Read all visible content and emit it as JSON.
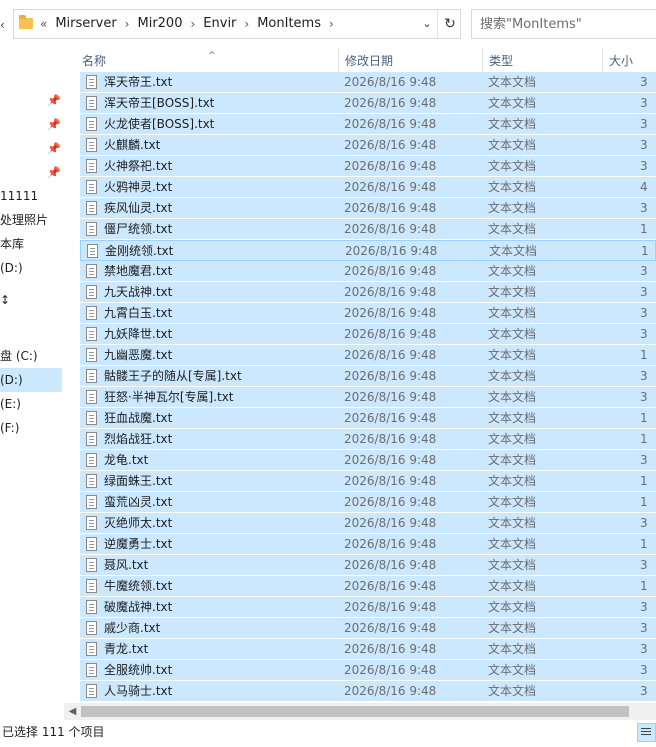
{
  "address": {
    "overflow": "«",
    "crumbs": [
      "Mirserver",
      "Mir200",
      "Envir",
      "MonItems"
    ]
  },
  "search": {
    "placeholder": "搜索\"MonItems\""
  },
  "sidebar": {
    "items": [
      {
        "label": "11111"
      },
      {
        "label": "处理照片"
      },
      {
        "label": "本库"
      },
      {
        "label": "(D:)"
      },
      {
        "label": "↕"
      },
      {
        "label": "盘 (C:)"
      },
      {
        "label": "(D:)"
      },
      {
        "label": "(E:)"
      },
      {
        "label": "(F:)"
      }
    ]
  },
  "columns": {
    "name": "名称",
    "date": "修改日期",
    "type": "类型",
    "size": "大小"
  },
  "files": [
    {
      "name": "浑天帝王.txt",
      "date": "2026/8/16 9:48",
      "type": "文本文档",
      "size": "3"
    },
    {
      "name": "浑天帝王[BOSS].txt",
      "date": "2026/8/16 9:48",
      "type": "文本文档",
      "size": "3"
    },
    {
      "name": "火龙使者[BOSS].txt",
      "date": "2026/8/16 9:48",
      "type": "文本文档",
      "size": "3"
    },
    {
      "name": "火麒麟.txt",
      "date": "2026/8/16 9:48",
      "type": "文本文档",
      "size": "3"
    },
    {
      "name": "火神祭祀.txt",
      "date": "2026/8/16 9:48",
      "type": "文本文档",
      "size": "3"
    },
    {
      "name": "火鸦神灵.txt",
      "date": "2026/8/16 9:48",
      "type": "文本文档",
      "size": "4"
    },
    {
      "name": "疾风仙灵.txt",
      "date": "2026/8/16 9:48",
      "type": "文本文档",
      "size": "3"
    },
    {
      "name": "僵尸统领.txt",
      "date": "2026/8/16 9:48",
      "type": "文本文档",
      "size": "1"
    },
    {
      "name": "金刚统领.txt",
      "date": "2026/8/16 9:48",
      "type": "文本文档",
      "size": "1"
    },
    {
      "name": "禁地魔君.txt",
      "date": "2026/8/16 9:48",
      "type": "文本文档",
      "size": "3"
    },
    {
      "name": "九天战神.txt",
      "date": "2026/8/16 9:48",
      "type": "文本文档",
      "size": "3"
    },
    {
      "name": "九霄白玉.txt",
      "date": "2026/8/16 9:48",
      "type": "文本文档",
      "size": "3"
    },
    {
      "name": "九妖降世.txt",
      "date": "2026/8/16 9:48",
      "type": "文本文档",
      "size": "3"
    },
    {
      "name": "九幽恶魔.txt",
      "date": "2026/8/16 9:48",
      "type": "文本文档",
      "size": "1"
    },
    {
      "name": "骷髅王子的随从[专属].txt",
      "date": "2026/8/16 9:48",
      "type": "文本文档",
      "size": "3"
    },
    {
      "name": "狂怒·半神瓦尔[专属].txt",
      "date": "2026/8/16 9:48",
      "type": "文本文档",
      "size": "3"
    },
    {
      "name": "狂血战魔.txt",
      "date": "2026/8/16 9:48",
      "type": "文本文档",
      "size": "1"
    },
    {
      "name": "烈焰战狂.txt",
      "date": "2026/8/16 9:48",
      "type": "文本文档",
      "size": "1"
    },
    {
      "name": "龙龟.txt",
      "date": "2026/8/16 9:48",
      "type": "文本文档",
      "size": "3"
    },
    {
      "name": "绿面蛛王.txt",
      "date": "2026/8/16 9:48",
      "type": "文本文档",
      "size": "1"
    },
    {
      "name": "蛮荒凶灵.txt",
      "date": "2026/8/16 9:48",
      "type": "文本文档",
      "size": "1"
    },
    {
      "name": "灭绝师太.txt",
      "date": "2026/8/16 9:48",
      "type": "文本文档",
      "size": "3"
    },
    {
      "name": "逆魔勇士.txt",
      "date": "2026/8/16 9:48",
      "type": "文本文档",
      "size": "1"
    },
    {
      "name": "聂风.txt",
      "date": "2026/8/16 9:48",
      "type": "文本文档",
      "size": "3"
    },
    {
      "name": "牛魔统领.txt",
      "date": "2026/8/16 9:48",
      "type": "文本文档",
      "size": "1"
    },
    {
      "name": "破魔战神.txt",
      "date": "2026/8/16 9:48",
      "type": "文本文档",
      "size": "3"
    },
    {
      "name": "戚少商.txt",
      "date": "2026/8/16 9:48",
      "type": "文本文档",
      "size": "3"
    },
    {
      "name": "青龙.txt",
      "date": "2026/8/16 9:48",
      "type": "文本文档",
      "size": "3"
    },
    {
      "name": "全服统帅.txt",
      "date": "2026/8/16 9:48",
      "type": "文本文档",
      "size": "3"
    },
    {
      "name": "人马骑士.txt",
      "date": "2026/8/16 9:48",
      "type": "文本文档",
      "size": "3"
    }
  ],
  "status": {
    "selection": "已选择 111 个项目"
  }
}
